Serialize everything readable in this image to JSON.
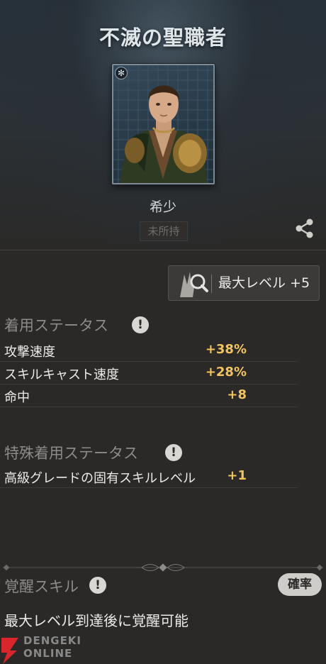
{
  "header": {
    "title": "不滅の聖職者"
  },
  "character": {
    "rarity": "希少",
    "owned_status": "未所持"
  },
  "max_level_button": {
    "label": "最大レベル +5"
  },
  "equip_status": {
    "title": "着用ステータス",
    "info_glyph": "!",
    "rows": [
      {
        "name": "攻撃速度",
        "value": "+38%"
      },
      {
        "name": "スキルキャスト速度",
        "value": "+28%"
      },
      {
        "name": "命中",
        "value": "+8"
      }
    ]
  },
  "special_status": {
    "title": "特殊着用ステータス",
    "info_glyph": "!",
    "rows": [
      {
        "name": "高級グレードの固有スキルレベル",
        "value": "+1"
      }
    ]
  },
  "awaken": {
    "title": "覚醒スキル",
    "info_glyph": "!",
    "probability_button": "確率",
    "description": "最大レベル到達後に覚醒可能"
  },
  "watermark": {
    "line1": "DENGEKI",
    "line2": "ONLINE"
  },
  "colors": {
    "accent_value": "#f2c45f",
    "background": "#2a2928"
  },
  "icons": {
    "share": "share-icon",
    "info": "info-icon",
    "magnify": "magnify-icon",
    "portrait_badge": "star-icon"
  }
}
